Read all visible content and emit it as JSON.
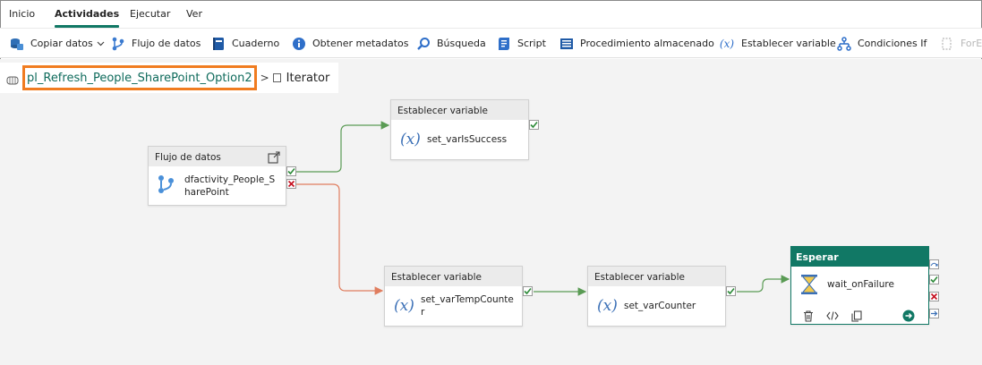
{
  "menu": {
    "tabs": [
      {
        "label": "Inicio"
      },
      {
        "label": "Actividades"
      },
      {
        "label": "Ejecutar"
      },
      {
        "label": "Ver"
      }
    ],
    "active_index": 1
  },
  "toolbar": {
    "items": [
      {
        "label": "Copiar datos",
        "icon": "copy-data-icon"
      },
      {
        "label": "Flujo de datos",
        "icon": "dataflow-icon"
      },
      {
        "label": "Cuaderno",
        "icon": "notebook-icon"
      },
      {
        "label": "Obtener metadatos",
        "icon": "info-icon"
      },
      {
        "label": "Búsqueda",
        "icon": "search-icon"
      },
      {
        "label": "Script",
        "icon": "script-icon"
      },
      {
        "label": "Procedimiento almacenado",
        "icon": "stored-procedure-icon"
      },
      {
        "label": "Establecer variable",
        "icon": "variable-icon"
      },
      {
        "label": "Condiciones If",
        "icon": "if-condition-icon"
      },
      {
        "label": "ForEa",
        "icon": "foreach-icon"
      }
    ]
  },
  "breadcrumb": {
    "pipeline": "pl_Refresh_People_SharePoint_Option2",
    "separator": ">",
    "current": "Iterator"
  },
  "nodes": {
    "dataflow": {
      "type": "Flujo de datos",
      "name_line1": "dfactivity_People_S",
      "name_line2": "harePoint"
    },
    "set_success": {
      "type": "Establecer variable",
      "name": "set_varIsSuccess",
      "glyph": "(x)"
    },
    "set_temp": {
      "type": "Establecer variable",
      "name_line1": "set_varTempCounte",
      "name_line2": "r",
      "glyph": "(x)"
    },
    "set_counter": {
      "type": "Establecer variable",
      "name": "set_varCounter",
      "glyph": "(x)"
    },
    "wait": {
      "type": "Esperar",
      "name": "wait_onFailure"
    }
  },
  "colors": {
    "accent": "#117865",
    "success": "#5a9b54",
    "failure": "#e07d5e",
    "highlight": "#f07c20"
  }
}
